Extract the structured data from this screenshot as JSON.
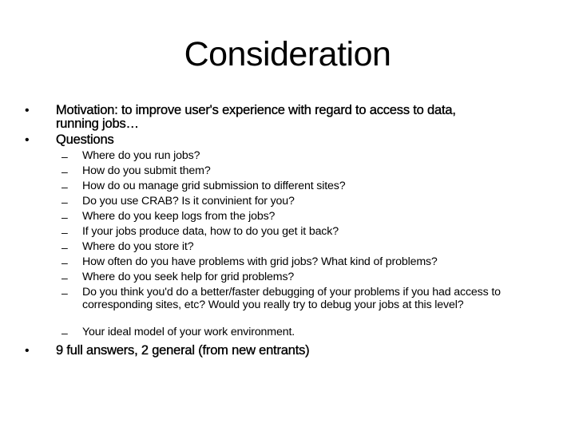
{
  "slide": {
    "title": "Consideration",
    "bullets": [
      {
        "marker": "•",
        "text": "Motivation: to improve user's experience with regard to access to data,",
        "text_cont": "running jobs…"
      },
      {
        "marker": "•",
        "text": "Questions",
        "sub_items": [
          {
            "marker": "–",
            "text": "Where do you run jobs?"
          },
          {
            "marker": "–",
            "text": "How do you submit them?"
          },
          {
            "marker": "–",
            "text": "How do ou manage grid submission to different sites?"
          },
          {
            "marker": "–",
            "text": "Do you use CRAB? Is it convinient for you?"
          },
          {
            "marker": "–",
            "text": "Where do you keep logs from the jobs?"
          },
          {
            "marker": "–",
            "text": "If your jobs produce data, how to do you get it back?"
          },
          {
            "marker": "–",
            "text": "Where do you store it?"
          },
          {
            "marker": "–",
            "text": "How often do you have problems with grid jobs? What kind of problems?"
          },
          {
            "marker": "–",
            "text": "Where do you seek help for grid problems?"
          },
          {
            "marker": "–",
            "text": "Do you think you'd do a better/faster debugging of your problems if you had access to corresponding sites, etc? Would you really try to debug your jobs at this level?"
          },
          {
            "marker": "–",
            "text": "Your ideal model of your work environment."
          }
        ]
      },
      {
        "marker": "•",
        "text": "9 full answers, 2 general (from new entrants)"
      }
    ]
  }
}
